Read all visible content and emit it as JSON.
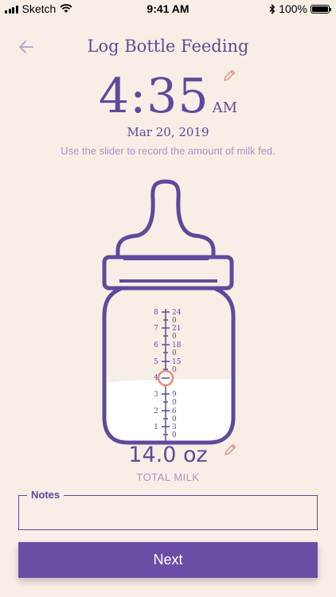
{
  "status_bar": {
    "carrier": "Sketch",
    "time": "9:41 AM",
    "battery": "100%"
  },
  "header": {
    "title": "Log Bottle Feeding",
    "back_icon": "back-arrow-icon"
  },
  "feeding_time": {
    "time": "4:35",
    "ampm": "AM",
    "date": "Mar 20, 2019",
    "edit_icon": "pencil-icon"
  },
  "instruction": "Use the slider to record the amount of milk fed.",
  "bottle": {
    "oz_scale": [
      "8",
      "7",
      "6",
      "5",
      "4",
      "3",
      "2",
      "1"
    ],
    "tbsp_scale": [
      "24",
      "0",
      "21",
      "0",
      "18",
      "0",
      "15",
      "0",
      "9",
      "0",
      "6",
      "0",
      "3",
      "0"
    ],
    "fill_level_oz": 3.6
  },
  "amount": {
    "value": "14.0 oz",
    "label": "TOTAL MILK",
    "edit_icon": "pencil-icon"
  },
  "notes": {
    "label": "Notes",
    "value": ""
  },
  "next_button": {
    "label": "Next"
  },
  "colors": {
    "background": "#f7efe6",
    "primary": "#5e4a9c",
    "accent_light": "#a793c7",
    "button": "#6a4ea6",
    "pencil": "#e88a7e"
  }
}
